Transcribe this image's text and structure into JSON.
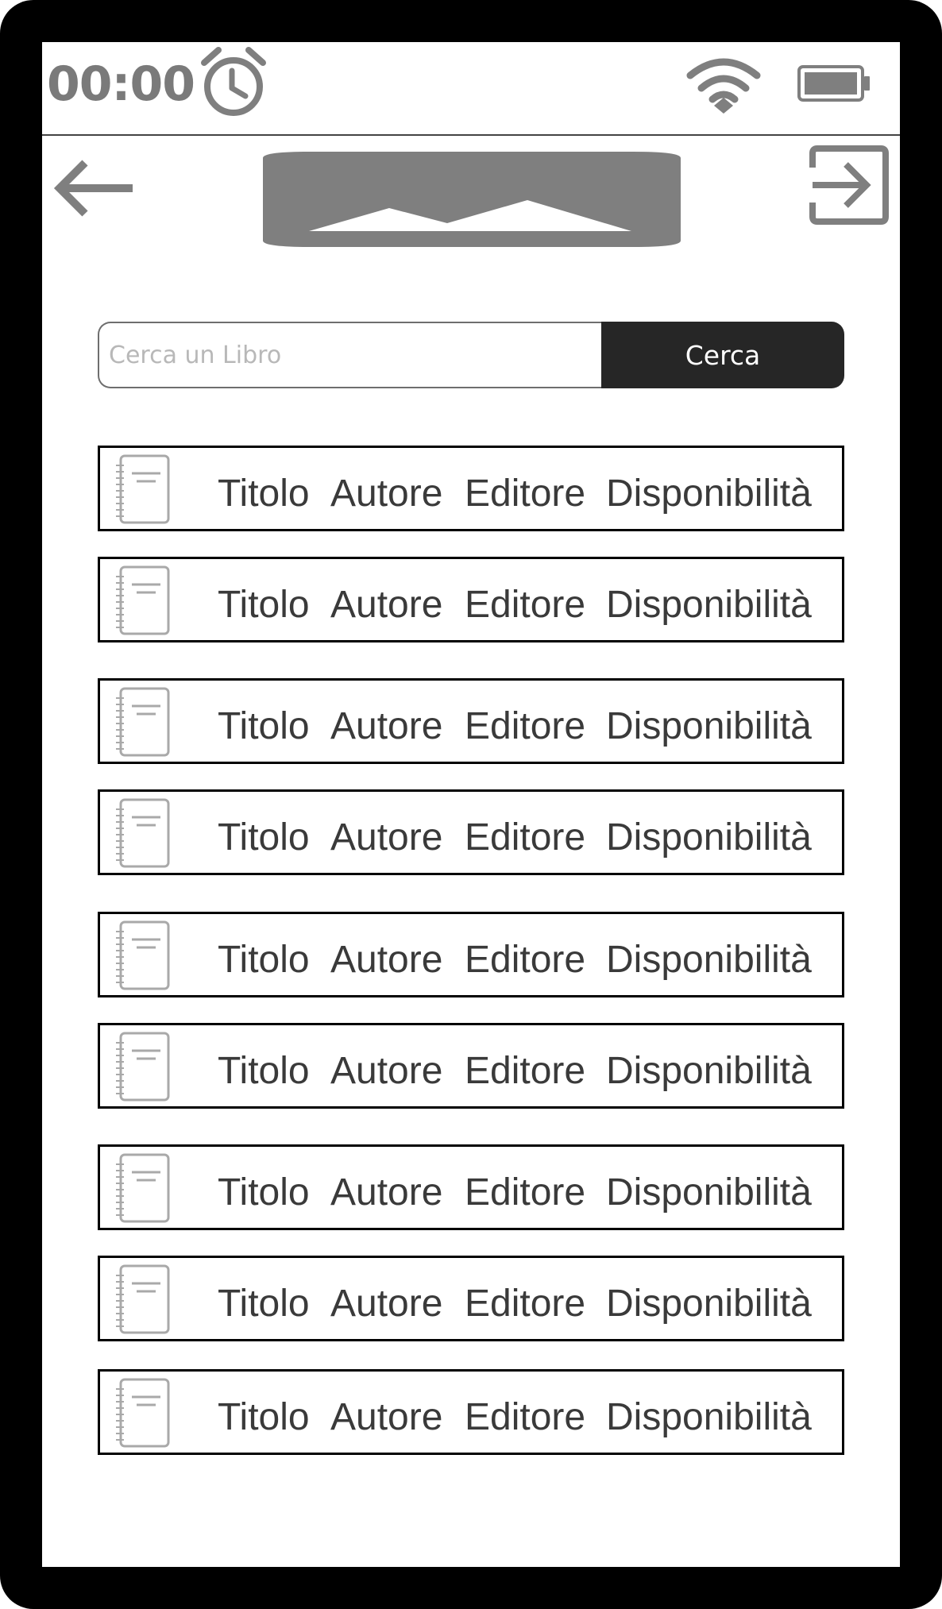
{
  "status_bar": {
    "time": "00:00",
    "alarm_icon": "alarm-clock-icon",
    "wifi_icon": "wifi-icon",
    "battery_icon": "battery-full-icon"
  },
  "header": {
    "back_icon": "arrow-left-icon",
    "logo_icon": "image-placeholder-icon",
    "logout_icon": "logout-icon"
  },
  "search": {
    "placeholder": "Cerca un Libro",
    "value": "",
    "button_label": "Cerca"
  },
  "books": [
    {
      "title": "Titolo",
      "author": "Autore",
      "publisher": "Editore",
      "availability": "Disponibilità",
      "icon": "notebook-icon"
    },
    {
      "title": "Titolo",
      "author": "Autore",
      "publisher": "Editore",
      "availability": "Disponibilità",
      "icon": "notebook-icon"
    },
    {
      "title": "Titolo",
      "author": "Autore",
      "publisher": "Editore",
      "availability": "Disponibilità",
      "icon": "notebook-icon"
    },
    {
      "title": "Titolo",
      "author": "Autore",
      "publisher": "Editore",
      "availability": "Disponibilità",
      "icon": "notebook-icon"
    },
    {
      "title": "Titolo",
      "author": "Autore",
      "publisher": "Editore",
      "availability": "Disponibilità",
      "icon": "notebook-icon"
    },
    {
      "title": "Titolo",
      "author": "Autore",
      "publisher": "Editore",
      "availability": "Disponibilità",
      "icon": "notebook-icon"
    },
    {
      "title": "Titolo",
      "author": "Autore",
      "publisher": "Editore",
      "availability": "Disponibilità",
      "icon": "notebook-icon"
    },
    {
      "title": "Titolo",
      "author": "Autore",
      "publisher": "Editore",
      "availability": "Disponibilità",
      "icon": "notebook-icon"
    },
    {
      "title": "Titolo",
      "author": "Autore",
      "publisher": "Editore",
      "availability": "Disponibilità",
      "icon": "notebook-icon"
    }
  ],
  "colors": {
    "frame": "#000000",
    "screen": "#ffffff",
    "icon_gray": "#7f7f7f",
    "search_button": "#262626",
    "search_button_text": "#ffffff",
    "row_text": "#3a3a3a",
    "row_border": "#000000"
  }
}
